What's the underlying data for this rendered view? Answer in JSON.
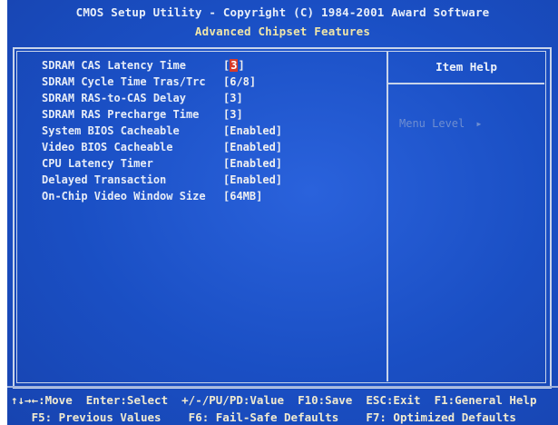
{
  "header": {
    "title": "CMOS Setup Utility - Copyright (C) 1984-2001 Award Software",
    "subtitle": "Advanced Chipset Features"
  },
  "help_panel": {
    "title": "Item Help",
    "menu_level_label": "Menu Level",
    "menu_level_arrow": "▸"
  },
  "settings": [
    {
      "label": "SDRAM CAS Latency Time",
      "value_prefix": "[",
      "value_cursor": "3",
      "value_suffix": "]"
    },
    {
      "label": "SDRAM Cycle Time Tras/Trc",
      "value": "[6/8]"
    },
    {
      "label": "SDRAM RAS-to-CAS Delay",
      "value": "[3]"
    },
    {
      "label": "SDRAM RAS Precharge Time",
      "value": "[3]"
    },
    {
      "label": "System BIOS Cacheable",
      "value": "[Enabled]"
    },
    {
      "label": "Video BIOS Cacheable",
      "value": "[Enabled]"
    },
    {
      "label": "CPU Latency Timer",
      "value": "[Enabled]"
    },
    {
      "label": "Delayed Transaction",
      "value": "[Enabled]"
    },
    {
      "label": "On-Chip Video Window Size",
      "value": "[64MB]"
    }
  ],
  "footer": {
    "line1": "↑↓→←:Move  Enter:Select  +/-/PU/PD:Value  F10:Save  ESC:Exit  F1:General Help",
    "line2": "   F5: Previous Values    F6: Fail-Safe Defaults    F7: Optimized Defaults"
  },
  "colors": {
    "background": "#1a4fc4",
    "frame": "#c8d4ea",
    "cursor": "#d63a2a",
    "subtitle": "#f0e6a8"
  }
}
